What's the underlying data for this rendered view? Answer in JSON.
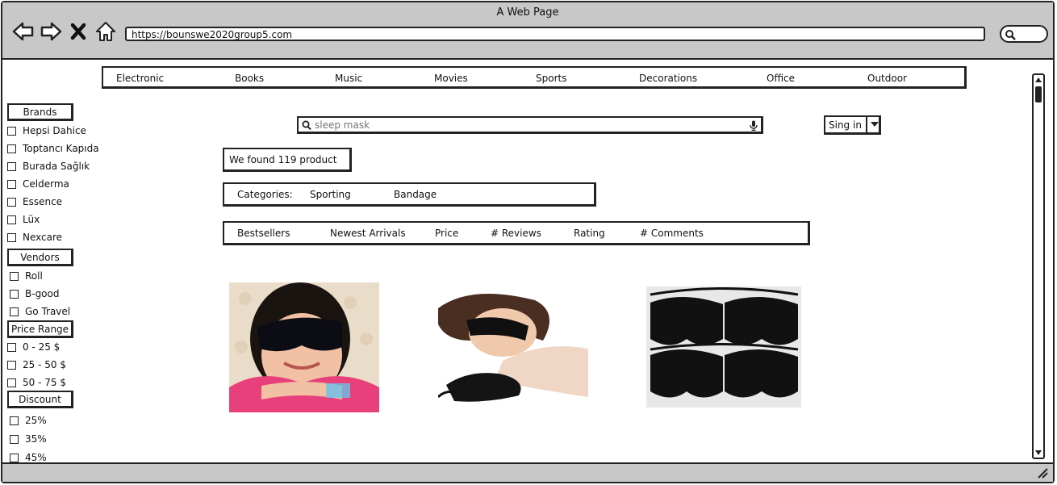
{
  "window": {
    "title": "A Web Page",
    "url": "https://bounswe2020group5.com"
  },
  "categories": [
    "Electronic",
    "Books",
    "Music",
    "Movies",
    "Sports",
    "Decorations",
    "Office",
    "Outdoor"
  ],
  "sidebar": {
    "brands": {
      "label": "Brands",
      "items": [
        "Hepsi Dahice",
        "Toptancı Kapıda",
        "Burada Sağlık",
        "Celderma",
        "Essence",
        "Lüx",
        "Nexcare"
      ]
    },
    "vendors": {
      "label": "Vendors",
      "items": [
        "Roll",
        "B-good",
        "Go Travel"
      ]
    },
    "price": {
      "label": "Price Range",
      "items": [
        "0 - 25 $",
        "25 - 50 $",
        "50 - 75 $"
      ]
    },
    "discount": {
      "label": "Discount",
      "items": [
        "25%",
        "35%",
        "45%"
      ]
    }
  },
  "search": {
    "placeholder": "sleep mask"
  },
  "signin": {
    "label": "Sing in"
  },
  "results": {
    "count_text": "We found 119 product"
  },
  "filter_categories": {
    "label": "Categories:",
    "items": [
      "Sporting",
      "Bandage"
    ]
  },
  "sort": {
    "items": [
      "Bestsellers",
      "Newest Arrivals",
      "Price",
      "# Reviews",
      "Rating",
      "# Comments"
    ]
  },
  "products": [
    {
      "name": "sleep-mask-girl"
    },
    {
      "name": "sleep-mask-woman"
    },
    {
      "name": "sleep-mask-pack"
    }
  ],
  "icons": [
    "back-arrow-icon",
    "forward-arrow-icon",
    "close-icon",
    "home-icon",
    "search-icon",
    "microphone-icon",
    "chevron-down-icon",
    "resize-icon"
  ]
}
